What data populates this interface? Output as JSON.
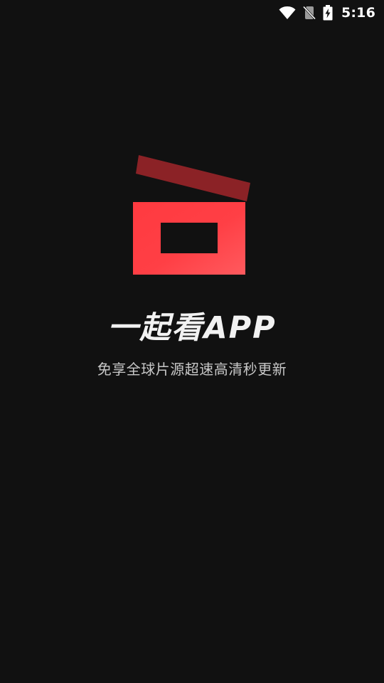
{
  "status_bar": {
    "time": "5:16",
    "icons": [
      "wifi-icon",
      "no-sim-icon",
      "battery-charging-icon"
    ]
  },
  "splash": {
    "logo_icon": "clapperboard-icon",
    "app_name": "一起看APP",
    "tagline": "免享全球片源超速高清秒更新"
  },
  "colors": {
    "background": "#111111",
    "logo_red": "#ff3a40",
    "logo_dark_red": "#8b2226",
    "text_primary": "#f2f2f2",
    "text_secondary": "#c8c8c8"
  }
}
